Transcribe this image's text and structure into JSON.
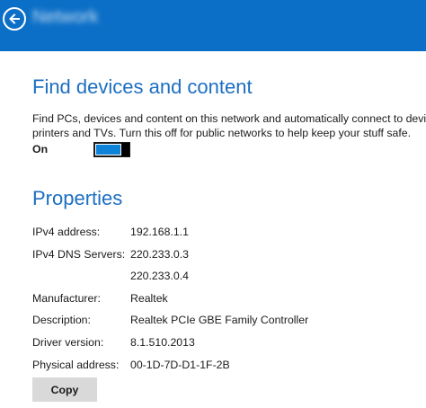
{
  "header": {
    "network_name": "Network",
    "accent": "#0c6fc7",
    "back_icon": "arrow-left-circle-icon"
  },
  "find_devices": {
    "title": "Find devices and content",
    "description_lines": [
      "Find PCs, devices and content on this network and automatically connect to devices like",
      "printers and TVs. Turn this off for public networks to help keep your stuff safe."
    ],
    "toggle_label": "On",
    "toggle_state": "on"
  },
  "properties": {
    "title": "Properties",
    "rows": [
      {
        "label": "IPv4 address:",
        "value": "192.168.1.1"
      },
      {
        "label": "IPv4 DNS Servers:",
        "value": "220.233.0.3"
      },
      {
        "label": "",
        "value": "220.233.0.4"
      },
      {
        "label": "Manufacturer:",
        "value": "Realtek"
      },
      {
        "label": "Description:",
        "value": "Realtek PCIe GBE Family Controller"
      },
      {
        "label": "Driver version:",
        "value": "8.1.510.2013"
      },
      {
        "label": "Physical address:",
        "value": "00-1D-7D-D1-1F-2B"
      }
    ],
    "copy_label": "Copy"
  }
}
